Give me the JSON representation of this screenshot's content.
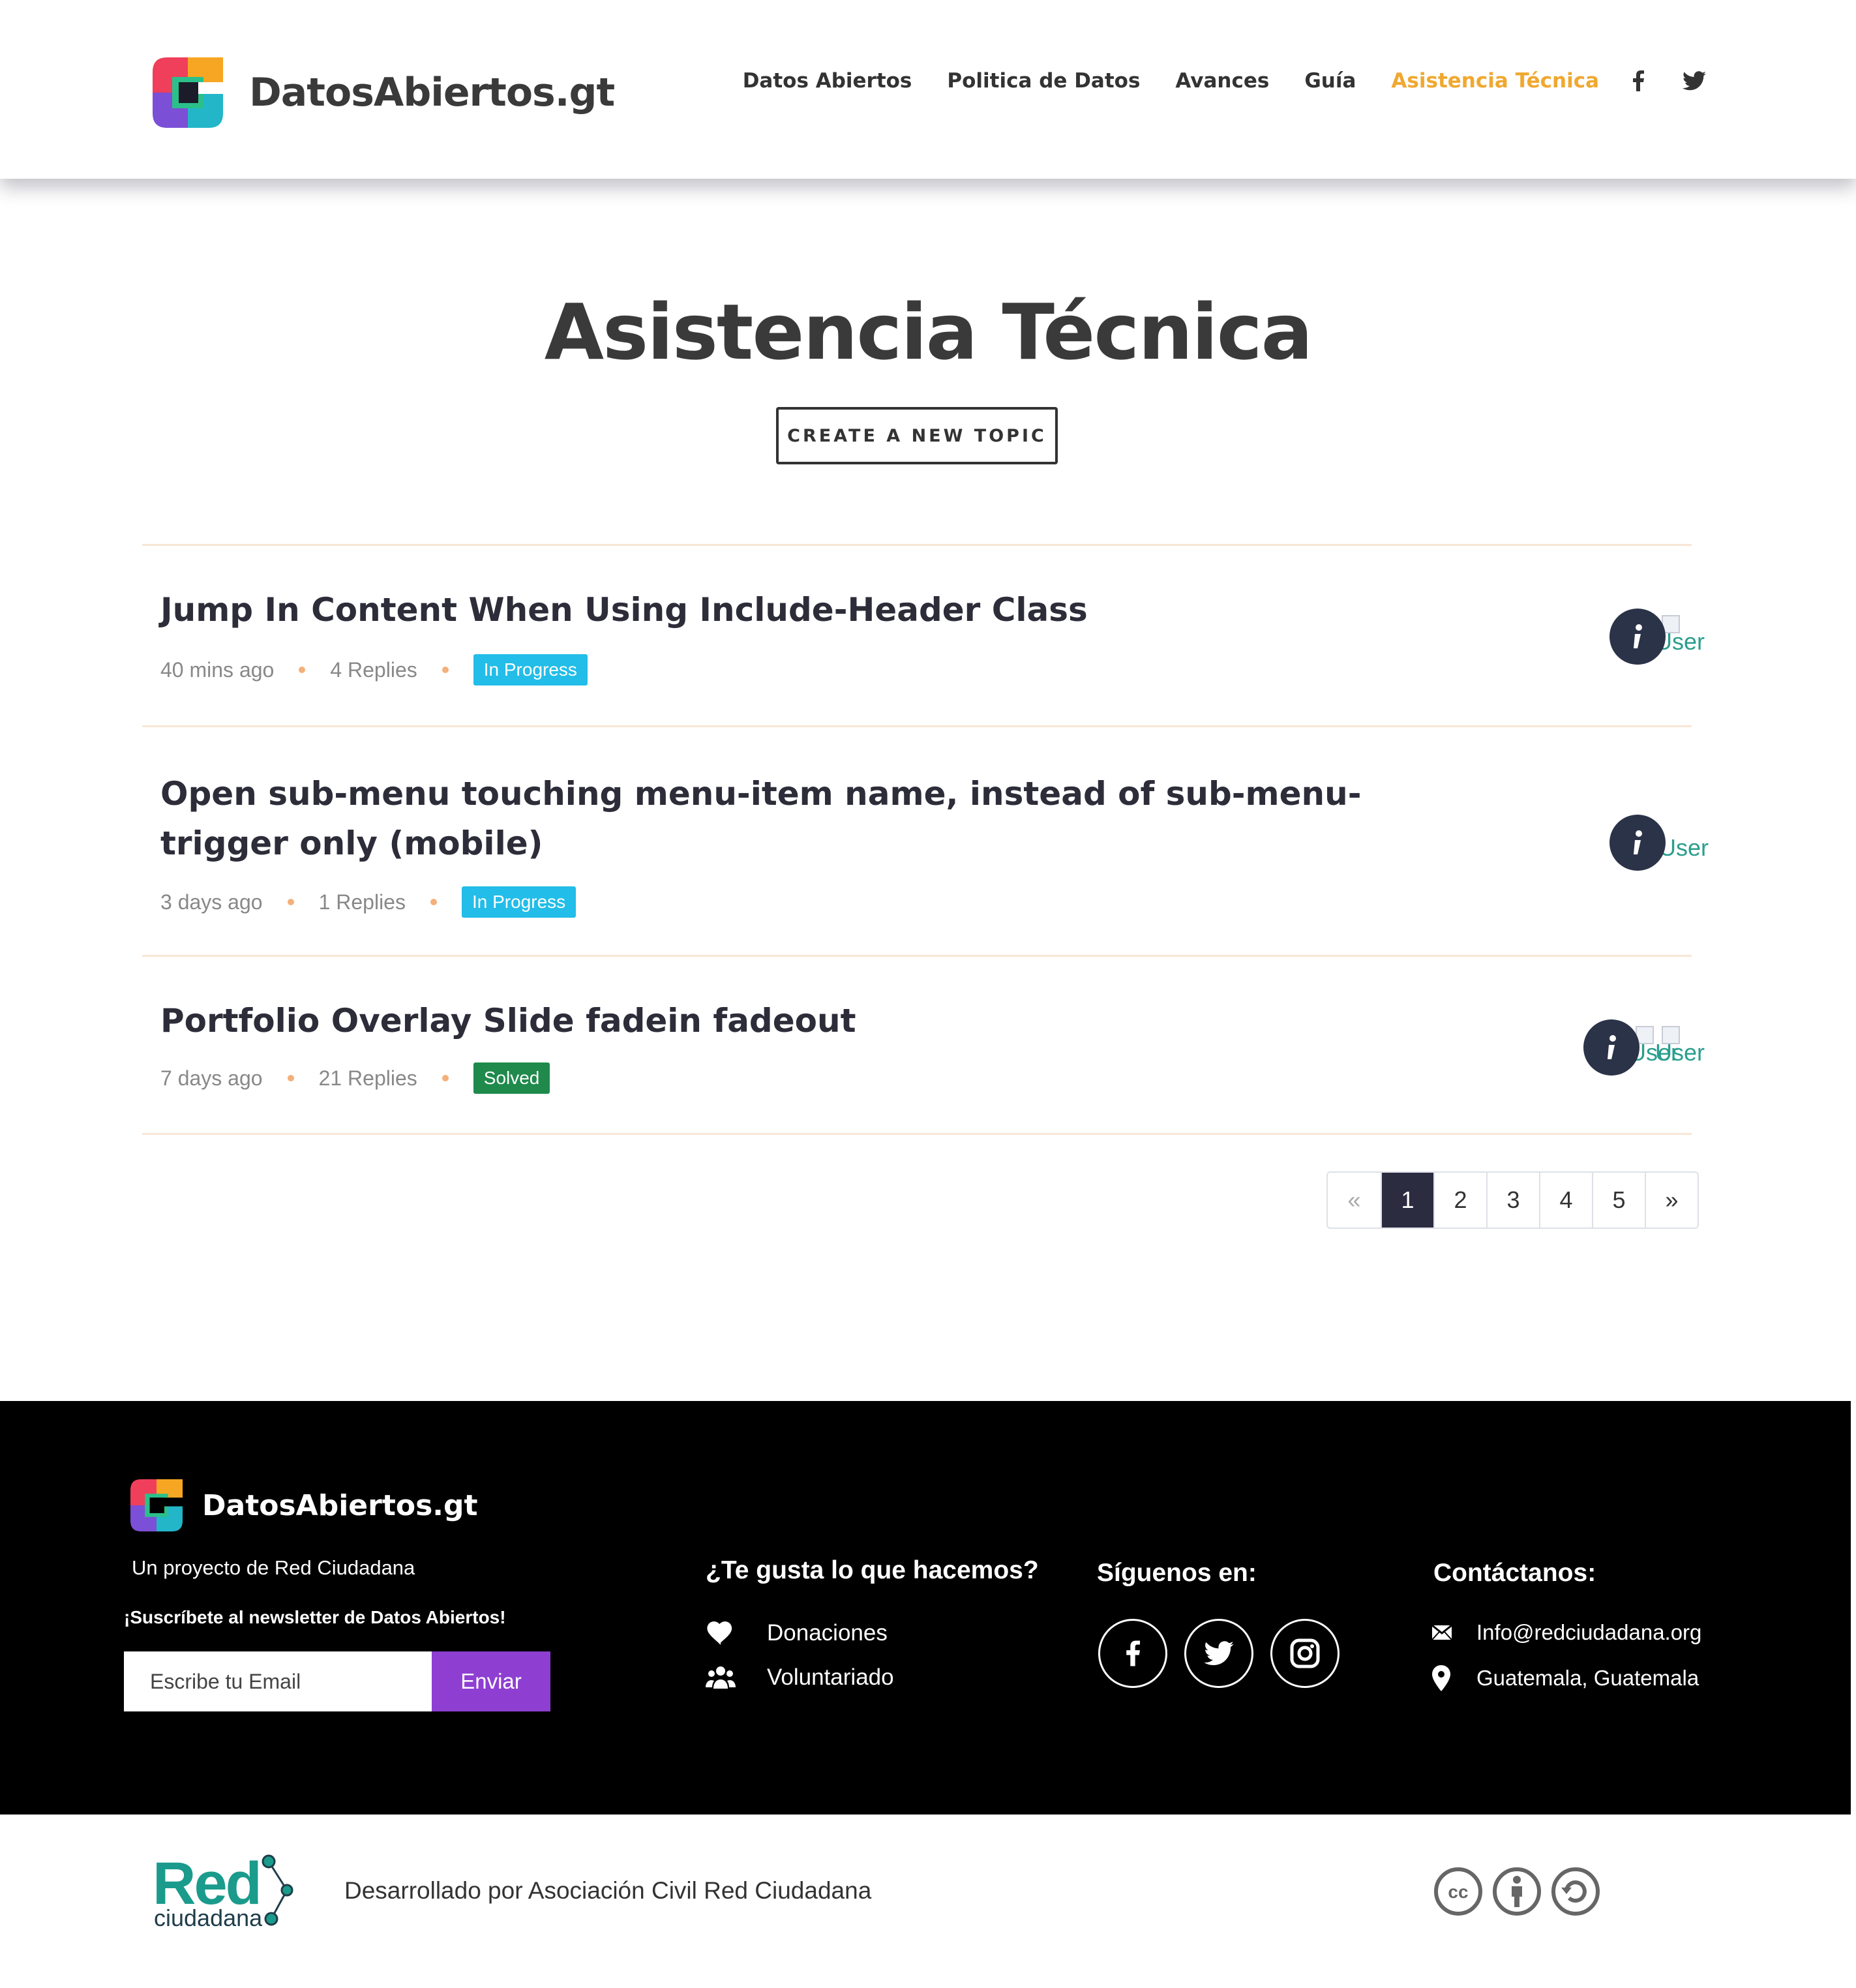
{
  "header": {
    "logo_text": "DatosAbiertos.gt",
    "nav": [
      {
        "label": "Datos Abiertos",
        "active": false
      },
      {
        "label": "Politica de Datos",
        "active": false
      },
      {
        "label": "Avances",
        "active": false
      },
      {
        "label": "Guía",
        "active": false
      },
      {
        "label": "Asistencia Técnica",
        "active": true
      }
    ],
    "social_icons": [
      "facebook-icon",
      "twitter-icon"
    ]
  },
  "hero": {
    "title": "Asistencia Técnica",
    "new_topic_label": "CREATE A NEW TOPIC"
  },
  "topics": [
    {
      "title": "Jump In Content When Using Include-Header Class",
      "time": "40 mins ago",
      "replies": "4 Replies",
      "status": "In Progress",
      "avatars_broken": 1,
      "broken_alt": "User"
    },
    {
      "title": "Open sub-menu touching menu-item name, instead of sub-menu-trigger only (mobile)",
      "time": "3 days ago",
      "replies": "1 Replies",
      "status": "In Progress",
      "avatars_broken": 0,
      "broken_alt": "User"
    },
    {
      "title": "Portfolio Overlay Slide fadein fadeout",
      "time": "7 days ago",
      "replies": "21 Replies",
      "status": "Solved",
      "avatars_broken": 2,
      "broken_alt": "User"
    }
  ],
  "pagination": {
    "prev": "«",
    "pages": [
      "1",
      "2",
      "3",
      "4",
      "5"
    ],
    "current": "1",
    "next": "»"
  },
  "footer": {
    "logo_text": "DatosAbiertos.gt",
    "subtitle": "Un proyecto de Red Ciudadana",
    "newsletter_label": "¡Suscríbete al newsletter de Datos Abiertos!",
    "email_placeholder": "Escribe tu Email",
    "submit_label": "Enviar",
    "like_heading": "¿Te gusta lo que hacemos?",
    "like_links": [
      {
        "label": "Donaciones",
        "icon": "heart-icon"
      },
      {
        "label": "Voluntariado",
        "icon": "users-icon"
      }
    ],
    "follow_heading": "Síguenos en:",
    "social": [
      "facebook-icon",
      "twitter-icon",
      "instagram-icon"
    ],
    "contact_heading": "Contáctanos:",
    "contact": [
      {
        "label": "Info@redciudadana.org",
        "icon": "envelope-icon"
      },
      {
        "label": "Guatemala, Guatemala",
        "icon": "map-pin-icon"
      }
    ]
  },
  "bottom": {
    "org_logo_line1": "Red",
    "org_logo_line2": "ciudadana",
    "developed_by": "Desarrollado por Asociación Civil Red Ciudadana",
    "license_badges": [
      "cc-icon",
      "attribution-icon",
      "share-alike-icon"
    ]
  },
  "colors": {
    "accent": "#f0a830",
    "in_progress": "#22bde8",
    "solved": "#1f8a4c",
    "submit": "#8e3fd2",
    "pagination_active": "#2b2c40",
    "footer_bg": "#000000",
    "red_ciudadana_teal": "#1a9b8c"
  }
}
